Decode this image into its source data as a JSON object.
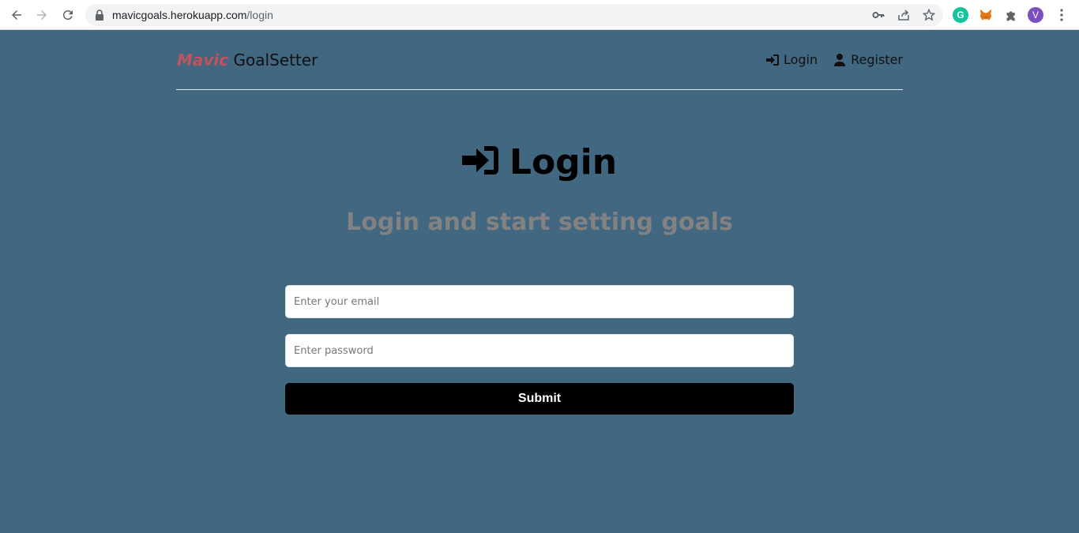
{
  "browser": {
    "url_host": "mavicgoals.herokuapp.com",
    "url_path": "/login",
    "extensions": {
      "grammarly_label": "G",
      "profile_initial": "V"
    }
  },
  "header": {
    "brand": "Mavic",
    "app_name": "GoalSetter",
    "nav": {
      "login_label": "Login",
      "register_label": "Register"
    }
  },
  "main": {
    "title": "Login",
    "subtitle": "Login and start setting goals",
    "email_placeholder": "Enter your email",
    "password_placeholder": "Enter password",
    "submit_label": "Submit"
  },
  "icons": {
    "back": "arrow-left-icon",
    "forward": "arrow-right-icon",
    "reload": "reload-icon",
    "lock": "lock-icon",
    "key": "key-icon",
    "share": "share-icon",
    "star": "star-icon",
    "metamask": "fox-icon",
    "extensions": "puzzle-icon",
    "menu": "kebab-menu-icon",
    "login": "sign-in-icon",
    "register": "user-icon"
  },
  "colors": {
    "background": "#416781",
    "brand": "#c0545d",
    "subtitle": "#828282",
    "button": "#000000"
  }
}
